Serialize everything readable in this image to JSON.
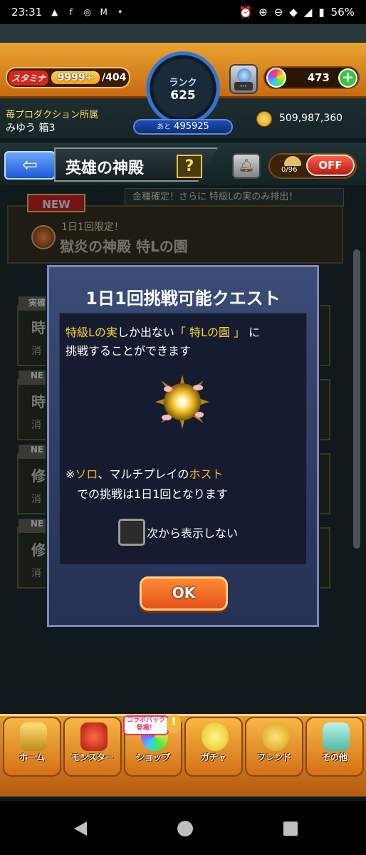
{
  "status_bar": {
    "time": "23:31",
    "battery": "56%"
  },
  "header": {
    "stamina_label": "スタミナ",
    "stamina_value": "9999+",
    "stamina_max": "/404",
    "rank_label": "ランク",
    "rank_value": "625",
    "exp_prefix": "あと",
    "exp_remaining": "495925",
    "gear_slot": "---",
    "orb_count": "473",
    "guild": "苺プロダクション所属",
    "username": "みゆう 箱3",
    "coins": "509,987,360"
  },
  "subheader": {
    "title": "英雄の神殿",
    "help": "?",
    "counter": "0/96",
    "toggle": "OFF"
  },
  "background": {
    "notice": "金種確定！さらに 特級Lの実のみ排出！",
    "event_badge": "NEW",
    "event_sub": "1日1回限定！",
    "event_name": "獄炎の神殿 特Lの園",
    "items": [
      {
        "tag": "実確",
        "title": "時",
        "sub": "消"
      },
      {
        "tag": "NE",
        "title": "時",
        "sub": "消"
      },
      {
        "tag": "NE",
        "title": "修",
        "sub": "消"
      },
      {
        "tag": "NE",
        "title": "修",
        "sub": "消"
      }
    ]
  },
  "modal": {
    "title": "1日1回挑戦可能クエスト",
    "line1_a": "特級Lの実",
    "line1_b": "しか出ない",
    "line1_c": "「 特Lの園 」",
    "line1_d": "に",
    "line2": "挑戦することができます",
    "note_a": "※",
    "note_b": "ソロ",
    "note_c": "、マルチプレイの",
    "note_d": "ホスト",
    "note_line2": "での挑戦は1日1回となります",
    "checkbox_label": "次から表示しない",
    "ok": "OK"
  },
  "bottom_nav": {
    "items": [
      "ホーム",
      "モンスター",
      "ショップ",
      "ガチャ",
      "フレンド",
      "その他"
    ],
    "badge": "コラボパック 登場！",
    "excl": "!"
  },
  "colors": {
    "accent_yellow": "#ffd43a",
    "accent_orange": "#ffb21e",
    "ok_button": "#e4521a"
  }
}
